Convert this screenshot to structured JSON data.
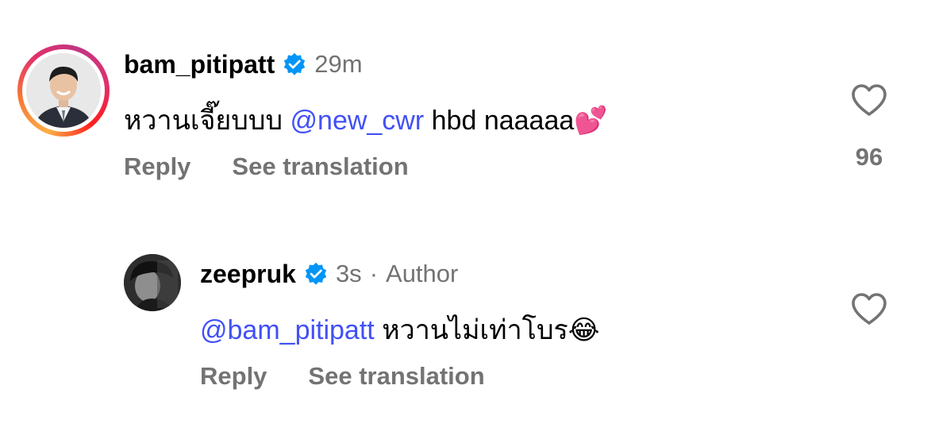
{
  "comments": [
    {
      "username": "bam_pitipatt",
      "time": "29m",
      "body_text": "หวานเจี๊ยบบบ",
      "mention": "@new_cwr",
      "body_tail": "hbd naaaaa",
      "emoji": "💕",
      "actions": {
        "reply": "Reply",
        "translate": "See translation"
      },
      "like_count": "96"
    }
  ],
  "replies": [
    {
      "username": "zeepruk",
      "time": "3s",
      "separator": "·",
      "role_label": "Author",
      "mention": "@bam_pitipatt",
      "body_text": "หวานไม่เท่าโบร",
      "emoji": "😂",
      "actions": {
        "reply": "Reply",
        "translate": "See translation"
      }
    }
  ],
  "colors": {
    "mention": "#4150f7",
    "secondary_text": "#737373",
    "verified_badge": "#0095f6",
    "story_ring": [
      "#fcaf45",
      "#e1306c",
      "#c13584"
    ]
  },
  "icons": {
    "verified": "verified-badge-icon",
    "like": "heart-outline-icon"
  }
}
